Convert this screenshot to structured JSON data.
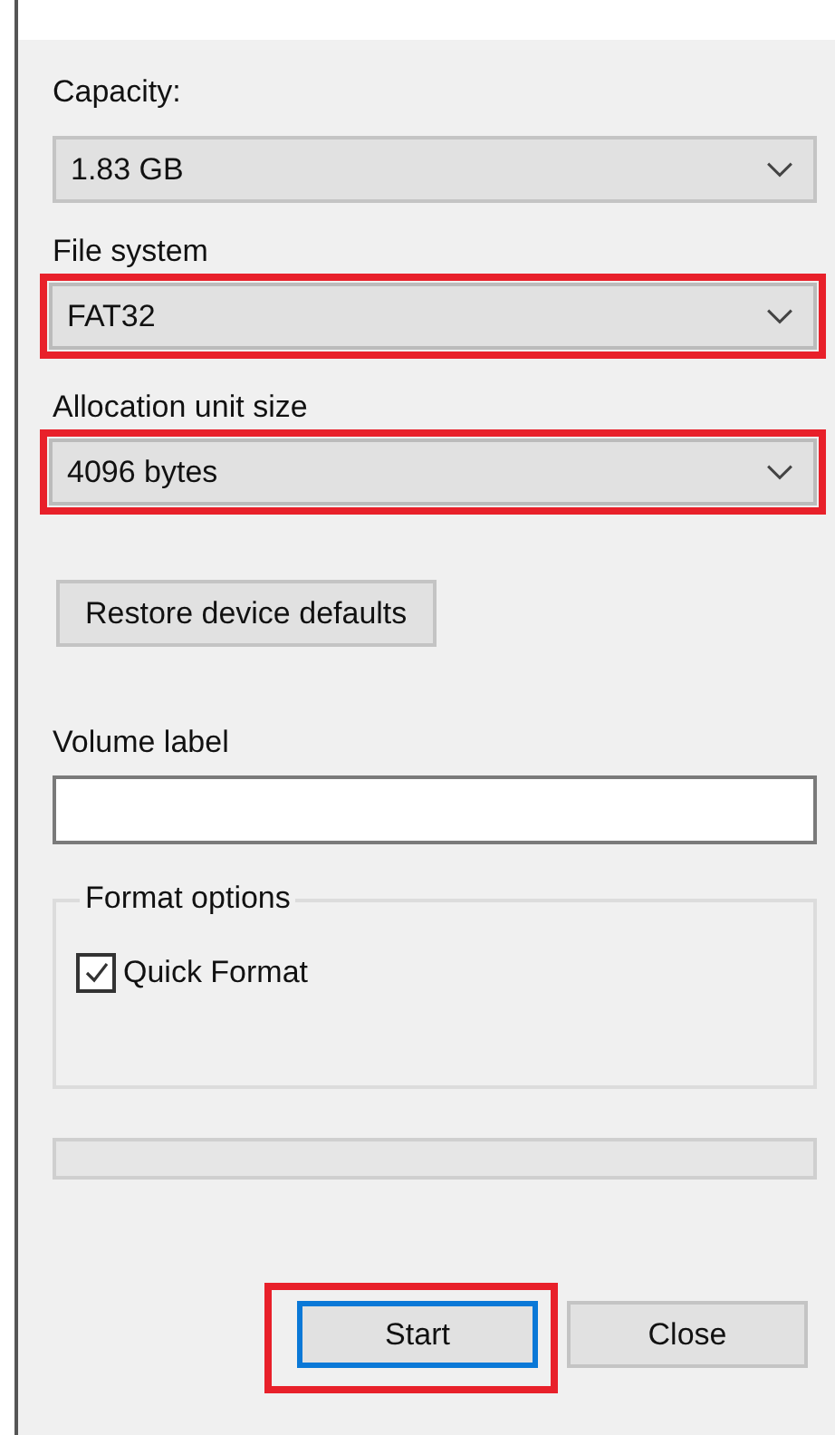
{
  "fields": [
    {
      "kind": "dropdown",
      "label": "Capacity:",
      "value": "1.83 GB",
      "highlighted": false
    },
    {
      "kind": "dropdown",
      "label": "File system",
      "value": "FAT32",
      "highlighted": true
    },
    {
      "kind": "dropdown",
      "label": "Allocation unit size",
      "value": "4096 bytes",
      "highlighted": true
    }
  ],
  "restore_button": {
    "label": "Restore device defaults"
  },
  "volume_label": {
    "label": "Volume label"
  },
  "format_options": {
    "title": "Format options",
    "options": [
      {
        "label": "Quick Format",
        "checked": true
      }
    ]
  },
  "progress": {
    "level": 0
  },
  "buttons": [
    {
      "label": "Start",
      "default": true,
      "highlighted": true
    },
    {
      "label": "Close",
      "default": false,
      "highlighted": false
    }
  ]
}
